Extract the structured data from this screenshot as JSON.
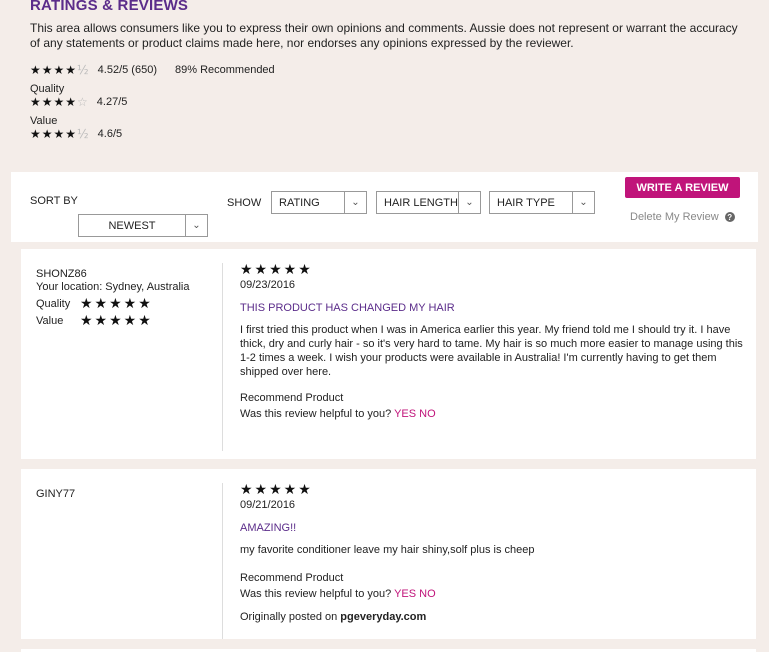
{
  "header": {
    "title": "RATINGS & REVIEWS",
    "disclaimer": "This area allows consumers like you to express their own opinions and comments. Aussie does not represent or warrant the accuracy of any statements or product claims made here, nor endorses any opinions expressed by the reviewer."
  },
  "summary": {
    "overall_stars": "★★★★",
    "overall_partial": "½",
    "overall_rating": "4.52/5 (650)",
    "recommended": "89% Recommended",
    "quality_label": "Quality",
    "quality_stars": "★★★★",
    "quality_dim": "☆",
    "quality_rating": "4.27/5",
    "value_label": "Value",
    "value_stars": "★★★★",
    "value_partial": "½",
    "value_rating": "4.6/5"
  },
  "toolbar": {
    "sort_label": "SORT BY",
    "sort_value": "NEWEST",
    "show_label": "SHOW",
    "filters": [
      "RATING",
      "HAIR LENGTH",
      "HAIR TYPE"
    ],
    "write_review": "WRITE A REVIEW",
    "delete_review": "Delete My Review",
    "help_glyph": "?"
  },
  "reviews": [
    {
      "user": "SHONZ86",
      "location": "Your location:  Sydney, Australia",
      "quality_label": "Quality",
      "value_label": "Value",
      "attr_stars": "★★★★★",
      "stars": "★★★★★",
      "date": "09/23/2016",
      "title": "THIS PRODUCT HAS CHANGED MY HAIR",
      "body": "I first tried this product when I was in America earlier this year. My friend told me I should try it. I have thick, dry and curly hair - so it's very hard to tame. My hair is so much more easier to manage using this 1-2 times a week. I wish your products were available in Australia! I'm currently having to get them shipped over here.",
      "recommend": "Recommend Product",
      "helpful_q": "Was this review helpful to you?",
      "yes": "YES",
      "no": "NO"
    },
    {
      "user": "GINY77",
      "stars": "★★★★★",
      "date": "09/21/2016",
      "title": "AMAZING!!",
      "body": "my favorite conditioner leave my hair shiny,solf plus is cheep",
      "recommend": "Recommend Product",
      "helpful_q": "Was this review helpful to you?",
      "yes": "YES",
      "no": "NO",
      "posted_prefix": "Originally posted on",
      "posted_site": "pgeveryday.com"
    }
  ],
  "colors": {
    "accent_purple": "#5b2c8a",
    "accent_magenta": "#c0147a",
    "background": "#f4ede9"
  }
}
